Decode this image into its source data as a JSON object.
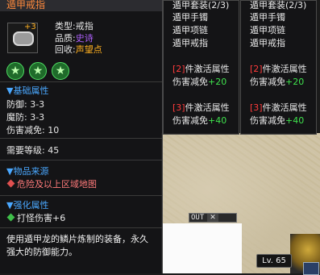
{
  "item": {
    "title": "遁甲戒指",
    "type_label": "类型:",
    "type_value": "戒指",
    "quality_label": "品质:",
    "quality_value": "史诗",
    "recycle_label": "回收:",
    "recycle_value": "声望点",
    "enhance_level": "+3",
    "stars": 3
  },
  "basic": {
    "header": "▼基础属性",
    "rows": [
      "防御: 3-3",
      "魔防: 3-3",
      "伤害减免: 10"
    ]
  },
  "level_req": "需要等级: 45",
  "source": {
    "header": "▼物品来源",
    "text": "危险及以上区域地图"
  },
  "strengthen": {
    "header": "▼强化属性",
    "text": "打怪伤害+6"
  },
  "description": "使用遁甲龙的鳞片炼制的装备，永久强大的防御能力。",
  "set_panels": [
    {
      "title": "遁甲套装(2/3)",
      "piece1": "遁甲手镯",
      "piece2": "遁甲项链",
      "piece3": "遁甲戒指",
      "bonus2_num": "2",
      "bonus2_text": "件激活属性",
      "bonus2_stat": "伤害减免",
      "bonus2_val": "+20",
      "bonus3_num": "3",
      "bonus3_text": "件激活属性",
      "bonus3_stat": "伤害减免",
      "bonus3_val": "+40"
    },
    {
      "title": "遁甲套装(2/3)",
      "piece1": "遁甲手镯",
      "piece2": "遁甲项链",
      "piece3": "遁甲戒指",
      "bonus2_num": "2",
      "bonus2_text": "件激活属性",
      "bonus2_stat": "伤害减免",
      "bonus2_val": "+20",
      "bonus3_num": "3",
      "bonus3_text": "件激活属性",
      "bonus3_stat": "伤害减免",
      "bonus3_val": "+40"
    }
  ],
  "hud": {
    "out_label": "OUT",
    "close_label": "✕",
    "level_badge": "Lv. 65"
  },
  "colors": {
    "title": "#ff8a3d",
    "epic": "#b061ff",
    "prestige": "#ffb020",
    "section": "#4aa8ff",
    "green": "#3fe24d",
    "red": "#ff3b3b",
    "source_text": "#ff7a7a"
  }
}
